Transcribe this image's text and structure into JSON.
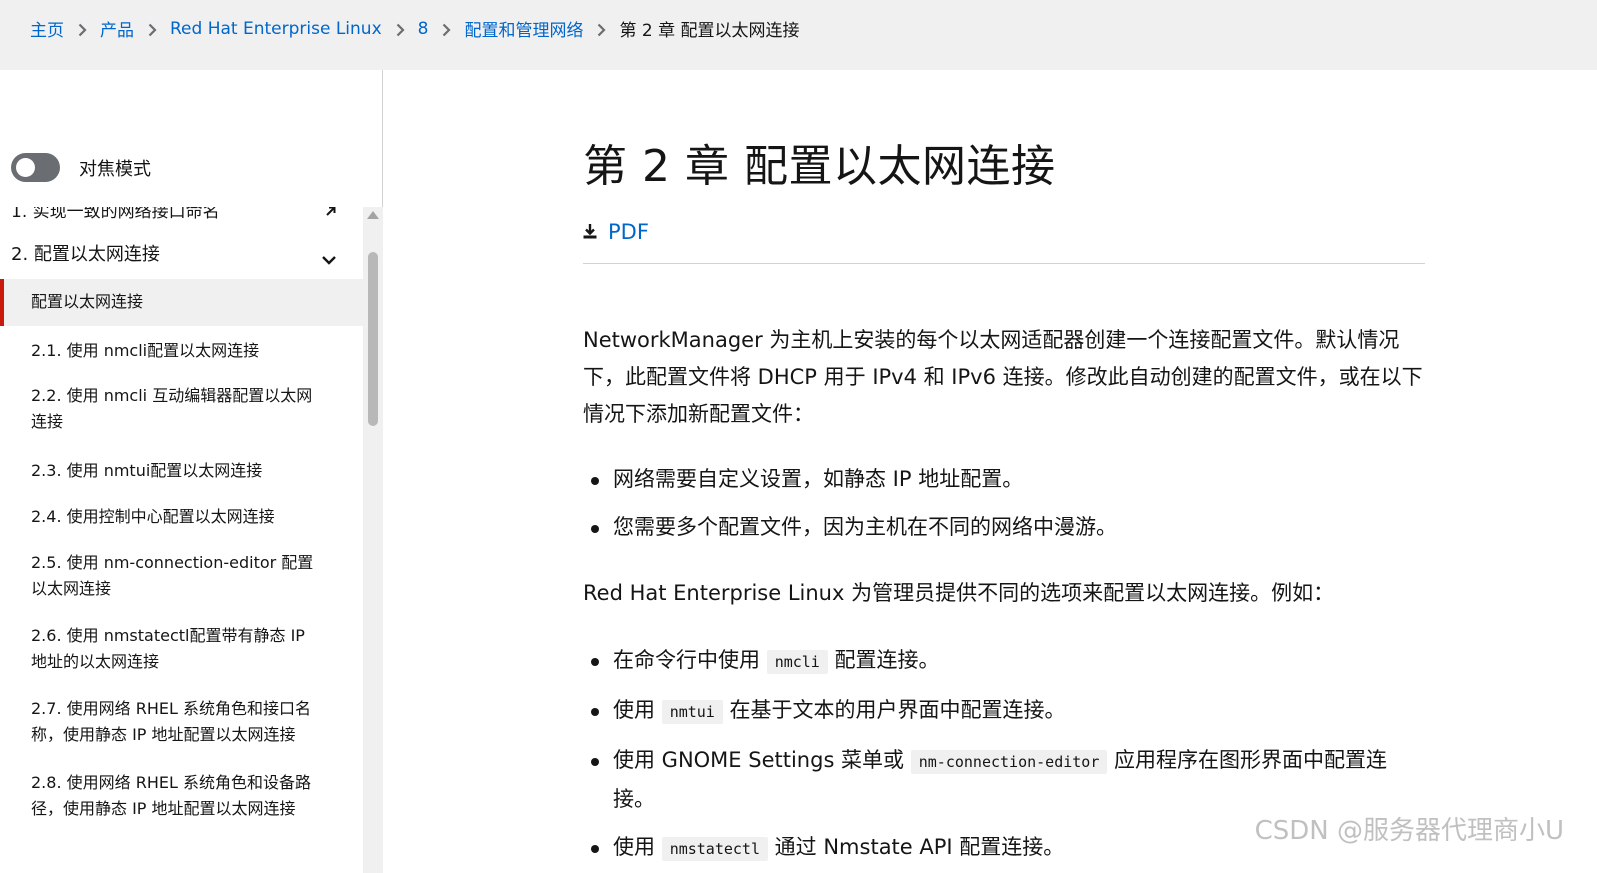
{
  "breadcrumb": {
    "items": [
      {
        "label": "主页"
      },
      {
        "label": "产品"
      },
      {
        "label": "Red Hat Enterprise Linux"
      },
      {
        "label": "8"
      },
      {
        "label": "配置和管理网络"
      }
    ],
    "current": "第 2 章 配置以太网连接"
  },
  "sidebar": {
    "focus_mode_label": "对焦模式",
    "focus_mode_on": false,
    "toc": {
      "partial_item": "1. 实现一致的网络接口命名",
      "chapter": "2. 配置以太网连接",
      "active_item": "配置以太网连接",
      "items": [
        {
          "label": "2.1. 使用 nmcli配置以太网连接"
        },
        {
          "label": "2.2. 使用 nmcli 互动编辑器配置以太网连接"
        },
        {
          "label": "2.3. 使用 nmtui配置以太网连接"
        },
        {
          "label": "2.4. 使用控制中心配置以太网连接"
        },
        {
          "label": "2.5. 使用 nm-connection-editor 配置以太网连接"
        },
        {
          "label": "2.6. 使用 nmstatectl配置带有静态 IP 地址的以太网连接"
        },
        {
          "label": "2.7. 使用网络 RHEL 系统角色和接口名称，使用静态 IP 地址配置以太网连接"
        },
        {
          "label": "2.8. 使用网络 RHEL 系统角色和设备路径，使用静态 IP 地址配置以太网连接"
        }
      ]
    }
  },
  "main": {
    "title": "第 2 章 配置以太网连接",
    "pdf_label": "PDF",
    "intro": "NetworkManager 为主机上安装的每个以太网适配器创建一个连接配置文件。默认情况下，此配置文件将 DHCP 用于 IPv4 和 IPv6 连接。修改此自动创建的配置文件，或在以下情况下添加新配置文件：",
    "cases": [
      "网络需要自定义设置，如静态 IP 地址配置。",
      "您需要多个配置文件，因为主机在不同的网络中漫游。"
    ],
    "options_intro": "Red Hat Enterprise Linux 为管理员提供不同的选项来配置以太网连接。例如：",
    "options": [
      {
        "before": "在命令行中使用 ",
        "code": "nmcli",
        "after": " 配置连接。"
      },
      {
        "before": "使用 ",
        "code": "nmtui",
        "after": " 在基于文本的用户界面中配置连接。"
      },
      {
        "before": "使用 GNOME Settings 菜单或 ",
        "code": "nm-connection-editor",
        "after": " 应用程序在图形界面中配置连接。"
      },
      {
        "before": "使用 ",
        "code": "nmstatectl",
        "after": " 通过 Nmstate API 配置连接。"
      }
    ]
  },
  "watermark": "CSDN @服务器代理商小U",
  "colors": {
    "link": "#0066cc",
    "active_marker": "#c9190b",
    "topbar_bg": "#f0f0f0",
    "toggle_off": "#6a6e73"
  }
}
